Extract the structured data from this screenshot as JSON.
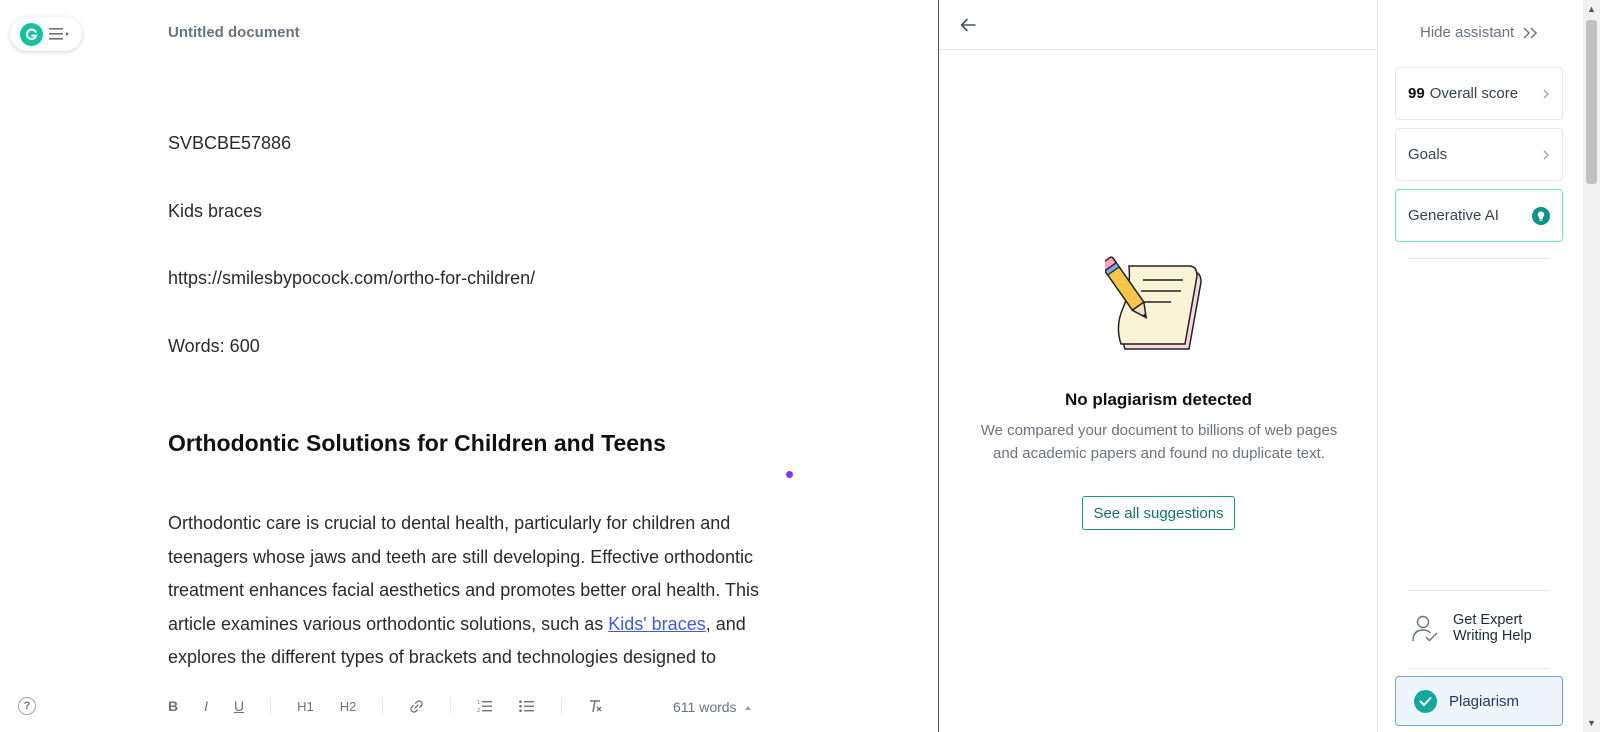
{
  "editor": {
    "doc_title": "Untitled document",
    "lines": [
      "SVBCBE57886",
      "Kids braces",
      "https://smilesbypocock.com/ortho-for-children/",
      "Words:  600"
    ],
    "heading": "Orthodontic Solutions for Children and Teens",
    "article": {
      "text_before_link": "Orthodontic care is crucial to dental health, particularly for children and teenagers whose jaws and teeth are still developing. Effective orthodontic treatment enhances facial aesthetics and promotes better oral health. This article examines various orthodontic solutions, such as ",
      "link_text": "Kids' braces",
      "text_after_link": ", and explores the different types of brackets and technologies designed to"
    },
    "toolbar": {
      "bold": "B",
      "italic": "I",
      "underline": "U",
      "h1": "H1",
      "h2": "H2",
      "link_icon": "link-icon",
      "ordered_list_icon": "ordered-list-icon",
      "bullet_list_icon": "bullet-list-icon",
      "clear_format_icon": "clear-format-icon"
    },
    "word_count": "611 words",
    "help_label": "?"
  },
  "plagiarism_card": {
    "back_icon": "back-arrow-icon",
    "heading": "No plagiarism detected",
    "description": "We compared your document to billions of web pages and academic papers and found no duplicate text.",
    "button_label": "See all suggestions"
  },
  "sidebar": {
    "hide_label": "Hide assistant",
    "score_value": "99",
    "score_label": "Overall score",
    "goals_label": "Goals",
    "genai_label": "Generative AI",
    "expert_label": "Get Expert Writing Help",
    "plagiarism_label": "Plagiarism"
  },
  "colors": {
    "grammarly_green": "#15c39a",
    "teal_button": "#0f9d88",
    "link_blue": "#3b5bdb",
    "plagiarism_bg": "#eef5fd",
    "purple_dot": "#7c3aed"
  }
}
